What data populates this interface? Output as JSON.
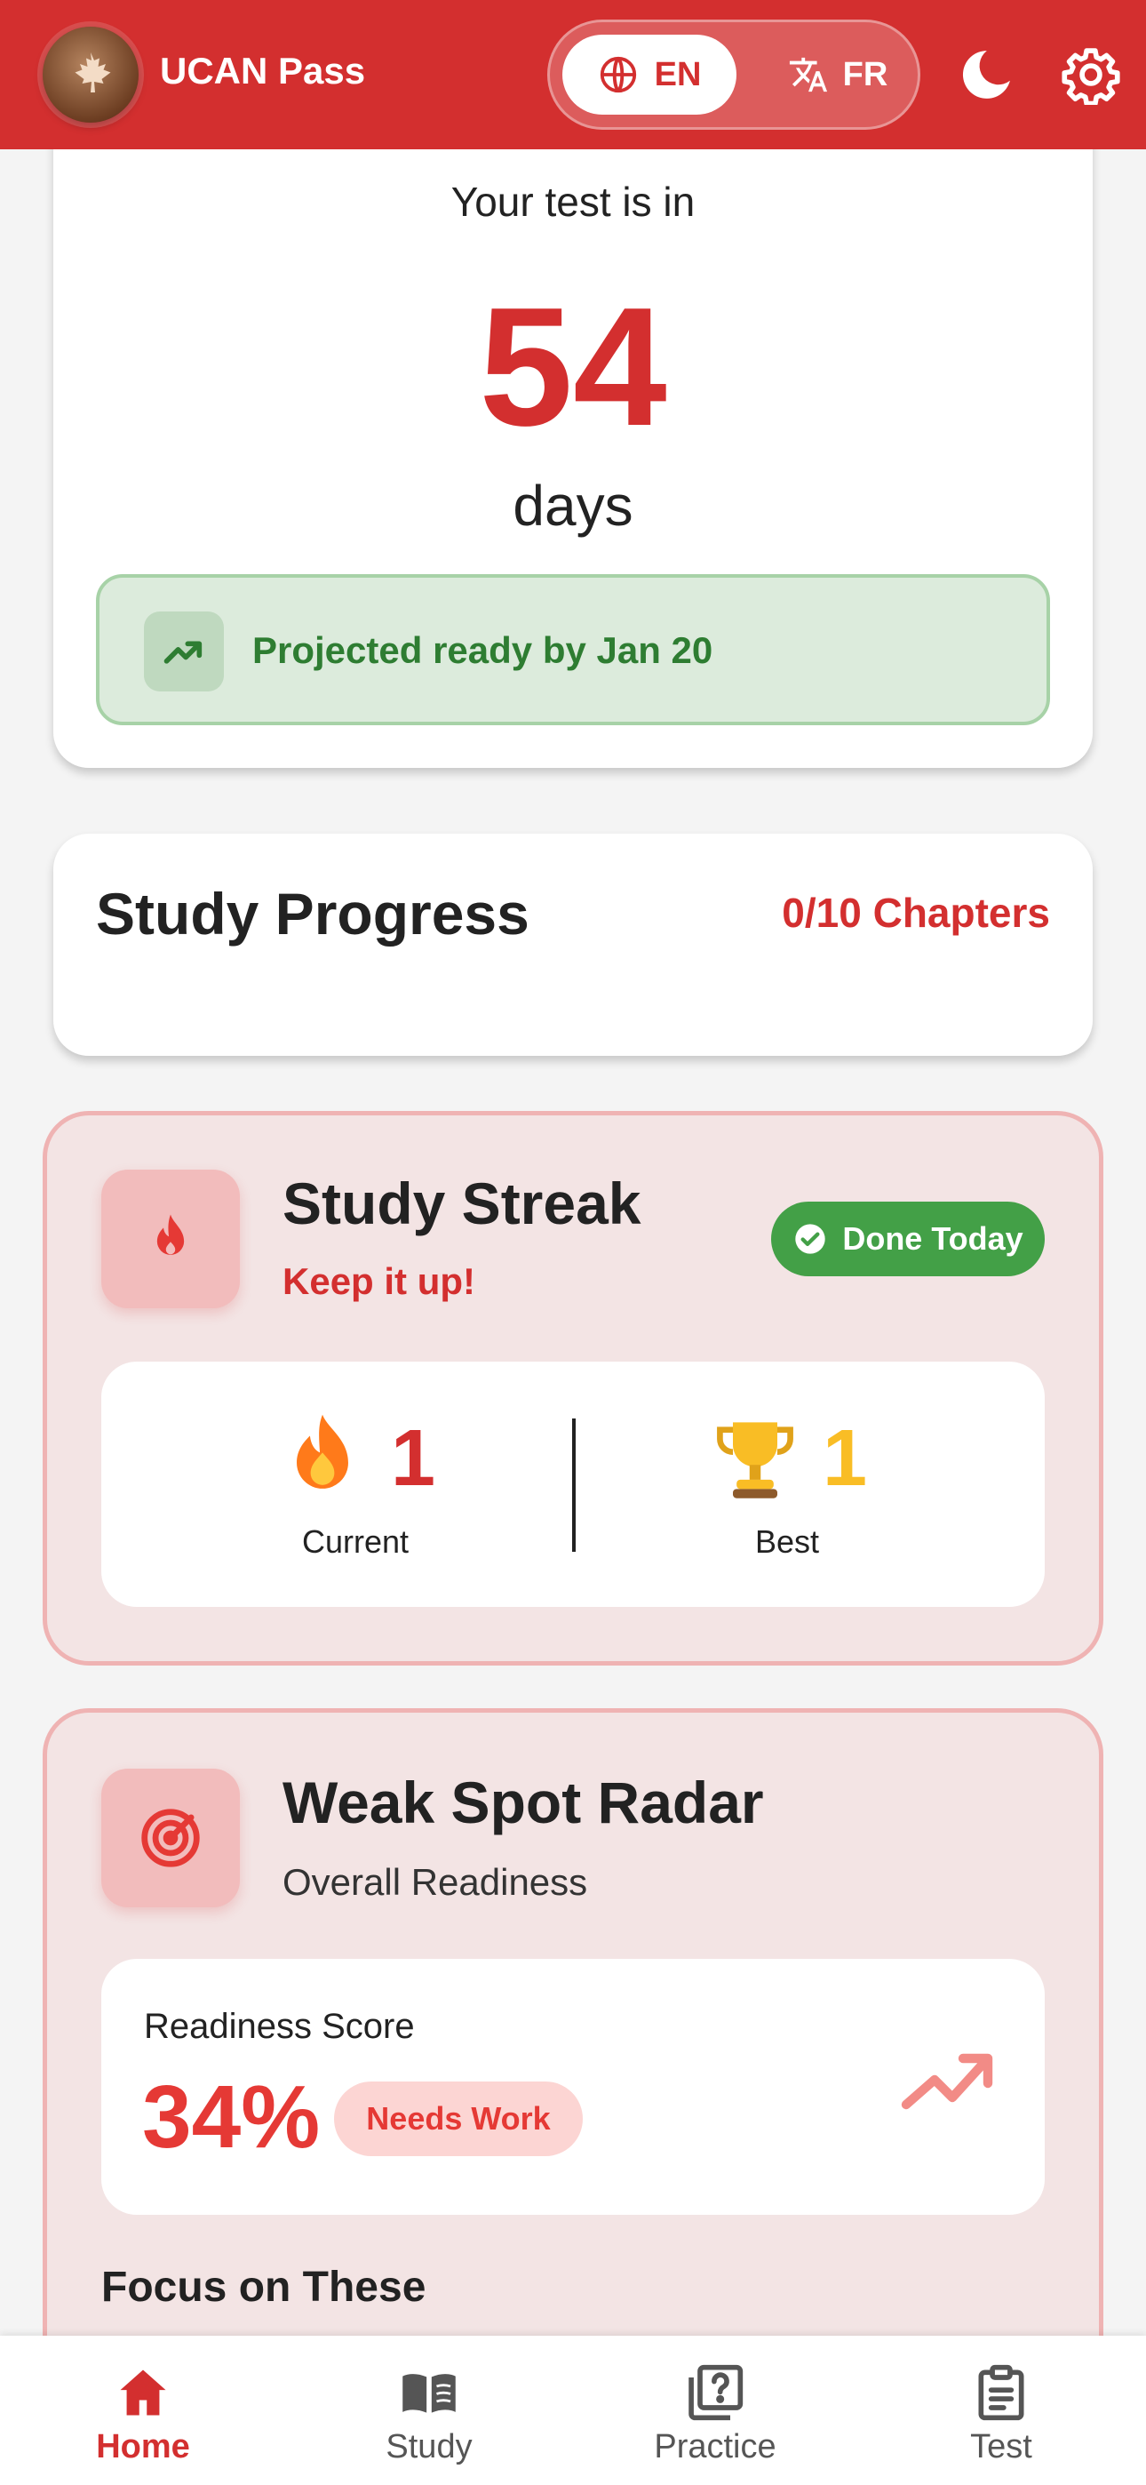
{
  "app": {
    "title": "UCAN Pass"
  },
  "language": {
    "en_label": "EN",
    "fr_label": "FR"
  },
  "countdown": {
    "label": "Your test is in",
    "days": "54",
    "unit": "days",
    "projected": "Projected ready by Jan 20"
  },
  "study_progress": {
    "title": "Study Progress",
    "count": "0/10 Chapters"
  },
  "streak": {
    "title": "Study Streak",
    "subtitle": "Keep it up!",
    "badge": "Done Today",
    "current_value": "1",
    "current_label": "Current",
    "best_value": "1",
    "best_label": "Best"
  },
  "radar": {
    "title": "Weak Spot Radar",
    "subtitle": "Overall Readiness",
    "score_label": "Readiness Score",
    "score_value": "34%",
    "status": "Needs Work",
    "focus_title": "Focus on These"
  },
  "nav": {
    "items": [
      {
        "label": "Home",
        "icon": "home-icon"
      },
      {
        "label": "Study",
        "icon": "book-icon"
      },
      {
        "label": "Practice",
        "icon": "quiz-icon"
      },
      {
        "label": "Test",
        "icon": "clipboard-icon"
      }
    ],
    "active": "Home"
  },
  "colors": {
    "primary": "#d32f2f",
    "success": "#43a047",
    "success_text": "#2e7d32",
    "warning_gold": "#f9bd25"
  }
}
